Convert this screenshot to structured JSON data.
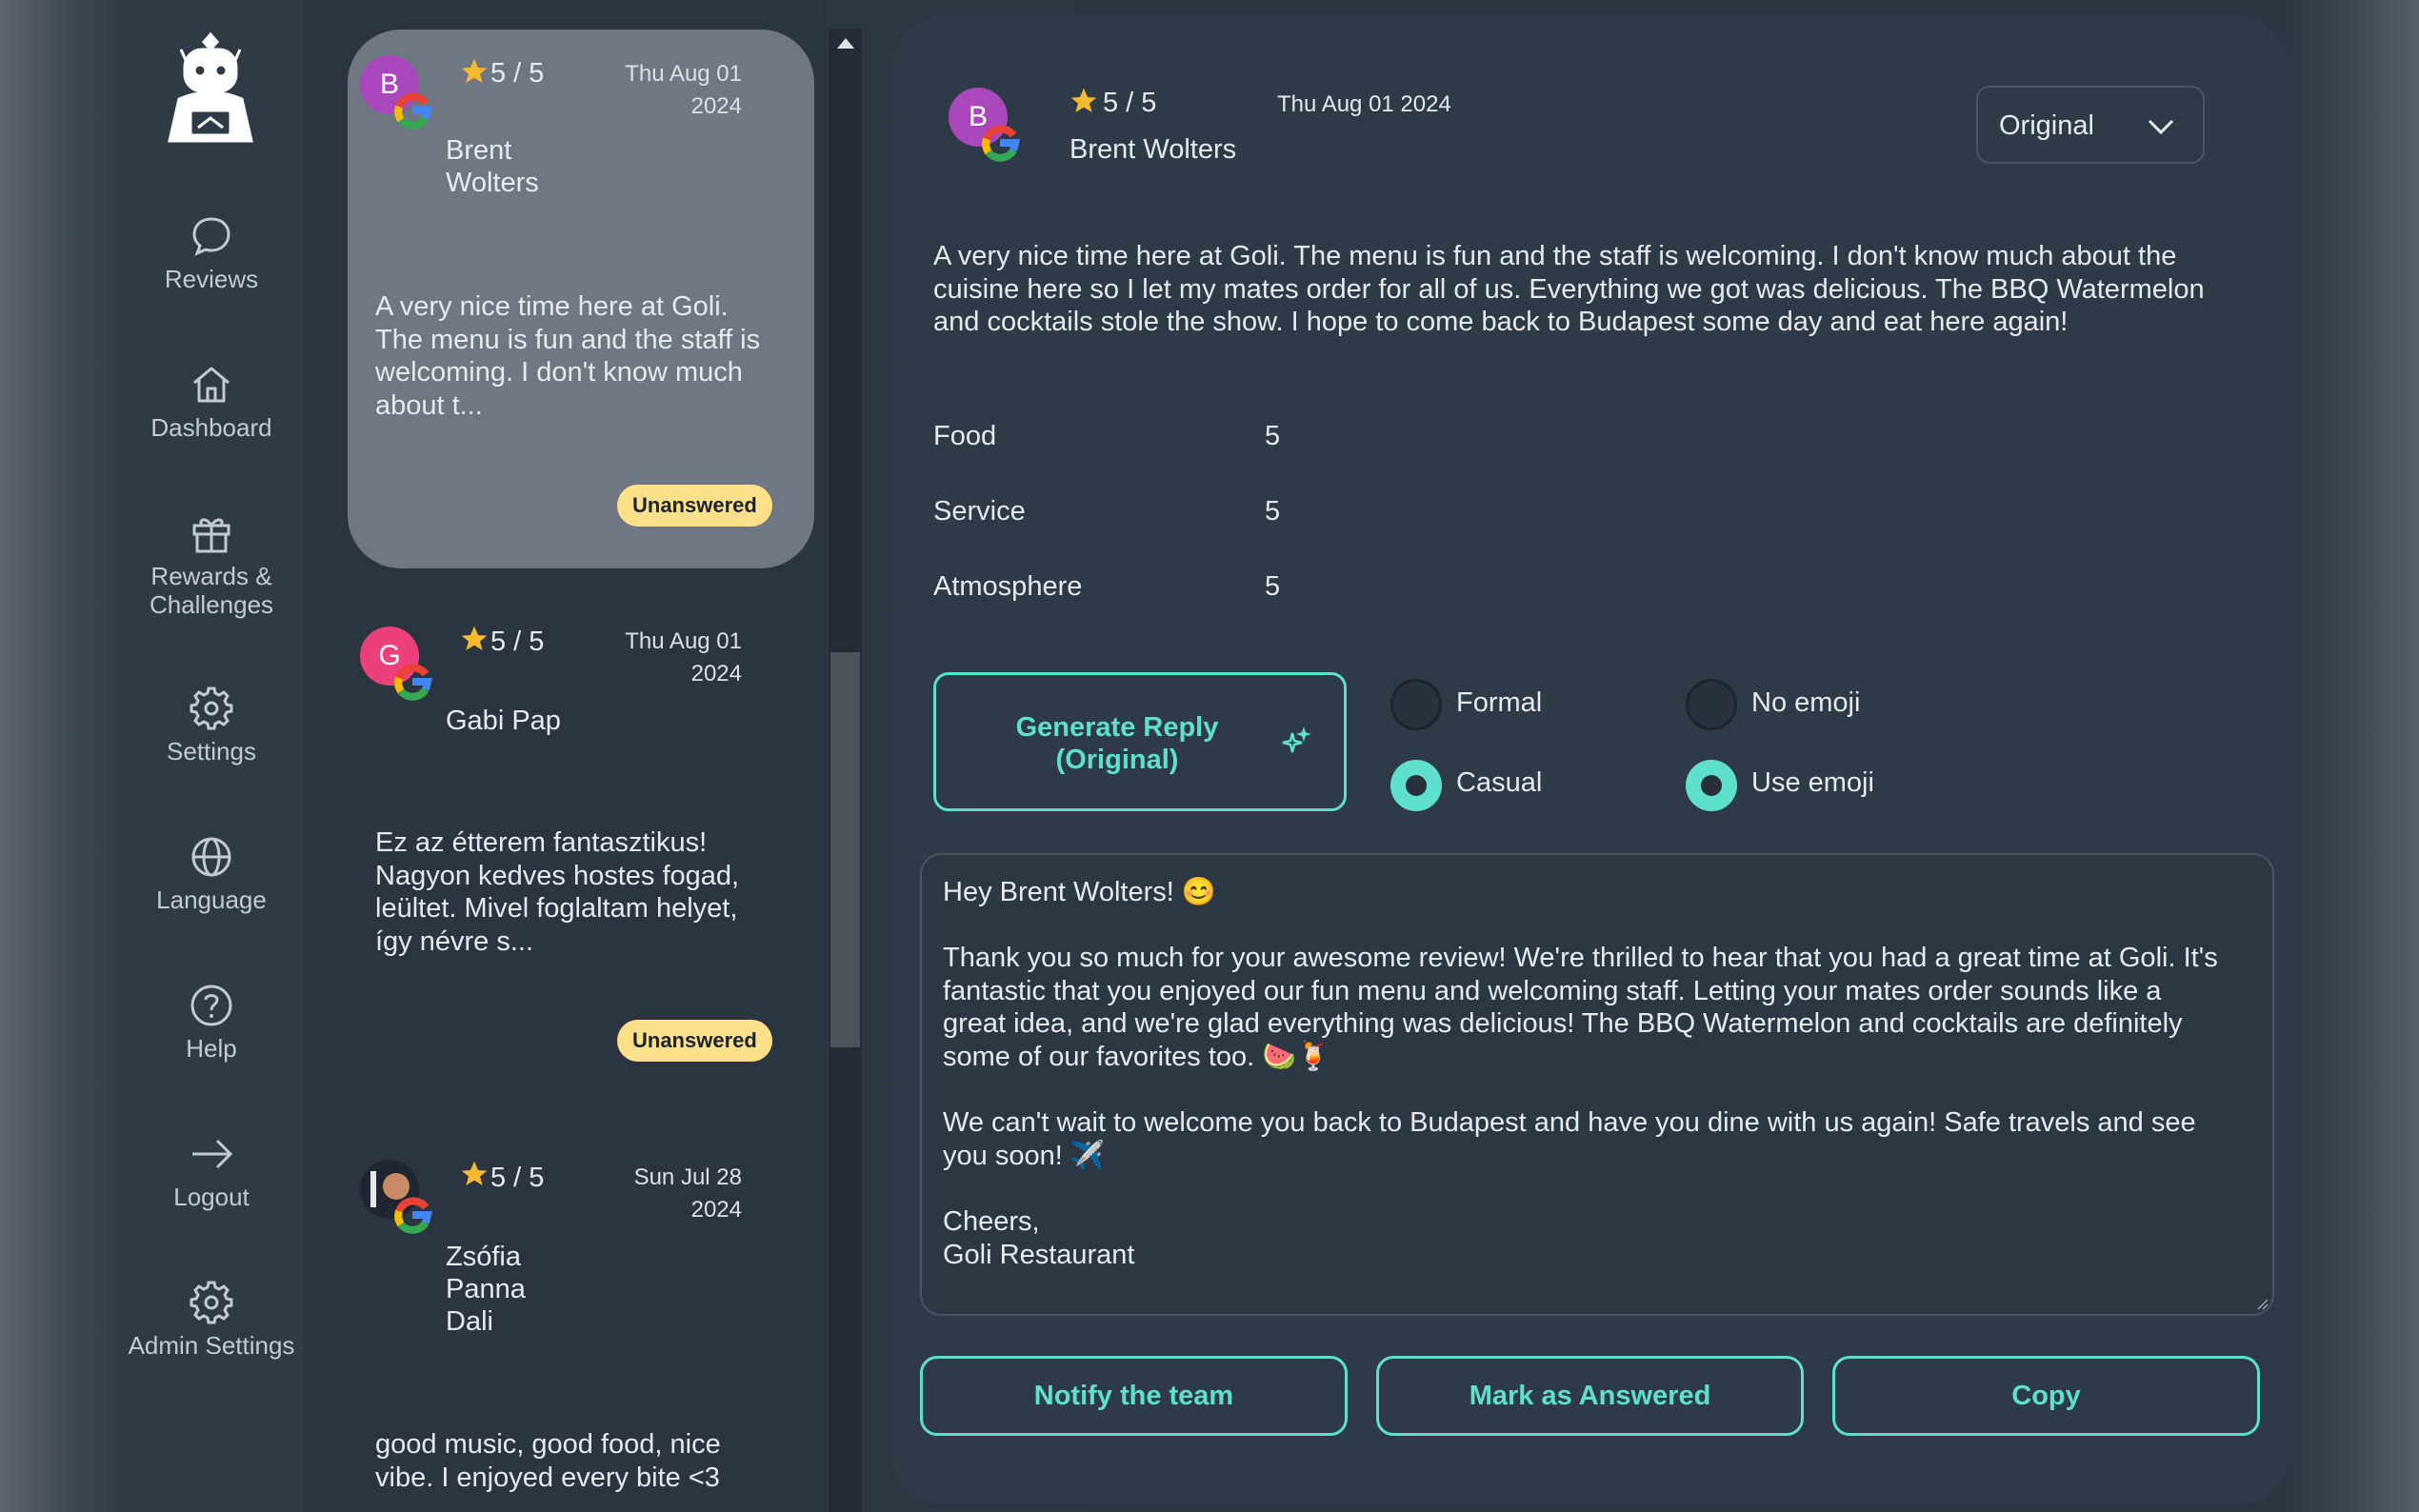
{
  "sidebar": {
    "items": [
      {
        "label": "Reviews",
        "icon": "chat-bubble-icon"
      },
      {
        "label": "Dashboard",
        "icon": "home-icon"
      },
      {
        "label": "Rewards &",
        "label2": "Challenges",
        "icon": "gift-icon"
      },
      {
        "label": "Settings",
        "icon": "gear-icon"
      },
      {
        "label": "Language",
        "icon": "globe-icon"
      },
      {
        "label": "Help",
        "icon": "question-icon"
      },
      {
        "label": "Logout",
        "icon": "arrow-right-icon"
      },
      {
        "label": "Admin Settings",
        "icon": "gear-icon"
      }
    ]
  },
  "reviews": [
    {
      "initial": "B",
      "avatar_color": "#ab47bc",
      "rating": "5 / 5",
      "date_line1": "Thu Aug 01",
      "date_line2": "2024",
      "author_line1": "Brent",
      "author_line2": "Wolters",
      "excerpt_lines": [
        "A very nice time here at Goli.",
        "The menu is fun and the staff is",
        "welcoming. I don't know much",
        "about t..."
      ],
      "status": "Unanswered"
    },
    {
      "initial": "G",
      "avatar_color": "#ec407a",
      "rating": "5 / 5",
      "date_line1": "Thu Aug 01",
      "date_line2": "2024",
      "author_line1": "Gabi Pap",
      "excerpt_lines": [
        "Ez az étterem fantasztikus!",
        "Nagyon kedves hostes fogad,",
        "leültet. Mivel foglaltam helyet,",
        "így névre s..."
      ],
      "status": "Unanswered"
    },
    {
      "rating": "5 / 5",
      "date_line1": "Sun Jul 28",
      "date_line2": "2024",
      "author_line1": "Zsófia",
      "author_line2": "Panna",
      "author_line3": "Dali",
      "excerpt_lines": [
        "good music, good food, nice",
        "vibe. I enjoyed every bite <3"
      ]
    }
  ],
  "detail": {
    "initial": "B",
    "rating": "5 / 5",
    "date": "Thu Aug 01 2024",
    "author": "Brent Wolters",
    "language_select": "Original",
    "review_lines": [
      "A very nice time here at Goli. The menu is fun and the staff is welcoming. I don't know much about the",
      "cuisine here so I let my mates order for all of us. Everything we got was delicious. The BBQ Watermelon",
      "and cocktails stole the show. I hope to come back to Budapest some day and eat here again!"
    ],
    "criteria": [
      {
        "name": "Food",
        "score": "5"
      },
      {
        "name": "Service",
        "score": "5"
      },
      {
        "name": "Atmosphere",
        "score": "5"
      }
    ],
    "generate_line1": "Generate Reply",
    "generate_line2": "(Original)",
    "tone_options": {
      "formal": "Formal",
      "casual": "Casual",
      "selected": "Casual"
    },
    "emoji_options": {
      "no_emoji": "No emoji",
      "use_emoji": "Use emoji",
      "selected": "Use emoji"
    },
    "reply_text": "Hey Brent Wolters! 😊\n\nThank you so much for your awesome review! We're thrilled to hear that you had a great time at Goli. It's\nfantastic that you enjoyed our fun menu and welcoming staff. Letting your mates order sounds like a\ngreat idea, and we're glad everything was delicious! The BBQ Watermelon and cocktails are definitely\nsome of our favorites too. 🍉🍹\n\nWe can't wait to welcome you back to Budapest and have you dine with us again! Safe travels and see\nyou soon! ✈️\n\nCheers,\nGoli Restaurant",
    "buttons": {
      "notify": "Notify the team",
      "mark_answered": "Mark as Answered",
      "copy": "Copy"
    }
  },
  "colors": {
    "accent": "#5fe0cc",
    "badge": "#fce08a",
    "active_card": "#6f7882"
  }
}
